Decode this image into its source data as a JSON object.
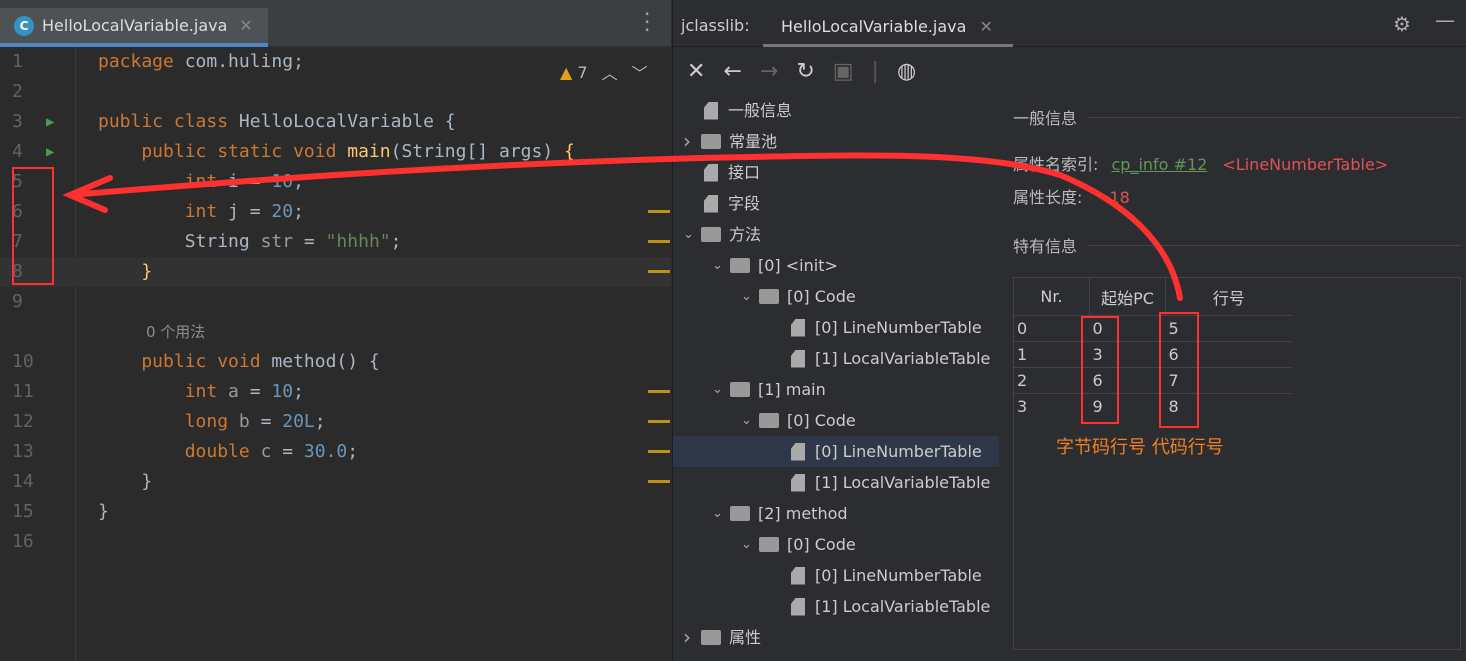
{
  "editor": {
    "tab": {
      "icon": "C",
      "label": "HelloLocalVariable.java",
      "close": "✕"
    },
    "warnings": {
      "count": "7"
    },
    "lines": [
      {
        "n": "1",
        "parts": [
          [
            "kw",
            "package "
          ],
          [
            "id",
            "com.huling;"
          ]
        ]
      },
      {
        "n": "2",
        "parts": []
      },
      {
        "n": "3",
        "run": true,
        "parts": [
          [
            "kw",
            "public class "
          ],
          [
            "id",
            "HelloLocalVariable {"
          ]
        ]
      },
      {
        "n": "4",
        "run": true,
        "parts": [
          [
            "kw",
            "    public static void "
          ],
          [
            "fn",
            "main"
          ],
          [
            "id",
            "(String[] args) "
          ],
          [
            "fn",
            "{"
          ]
        ]
      },
      {
        "n": "5",
        "parts": [
          [
            "kw",
            "        int "
          ],
          [
            "id",
            "i = "
          ],
          [
            "num",
            "10"
          ],
          [
            "id",
            ";"
          ]
        ]
      },
      {
        "n": "6",
        "parts": [
          [
            "kw",
            "        int "
          ],
          [
            "id",
            "j = "
          ],
          [
            "num",
            "20"
          ],
          [
            "id",
            ";"
          ]
        ]
      },
      {
        "n": "7",
        "parts": [
          [
            "id",
            "        String "
          ],
          [
            "var",
            "str"
          ],
          [
            "id",
            " = "
          ],
          [
            "str",
            "\"hhhh\""
          ],
          [
            "id",
            ";"
          ]
        ]
      },
      {
        "n": "8",
        "cur": true,
        "parts": [
          [
            "fn",
            "    }"
          ]
        ]
      },
      {
        "n": "9",
        "parts": []
      },
      {
        "n": "",
        "hint": "0 个用法",
        "parts": []
      },
      {
        "n": "10",
        "parts": [
          [
            "kw",
            "    public void "
          ],
          [
            "id",
            "method() {"
          ]
        ]
      },
      {
        "n": "11",
        "parts": [
          [
            "kw",
            "        int "
          ],
          [
            "var",
            "a"
          ],
          [
            "id",
            " = "
          ],
          [
            "num",
            "10"
          ],
          [
            "id",
            ";"
          ]
        ]
      },
      {
        "n": "12",
        "parts": [
          [
            "kw",
            "        long "
          ],
          [
            "var",
            "b"
          ],
          [
            "id",
            " = "
          ],
          [
            "num",
            "20L"
          ],
          [
            "id",
            ";"
          ]
        ]
      },
      {
        "n": "13",
        "parts": [
          [
            "kw",
            "        double "
          ],
          [
            "var",
            "c"
          ],
          [
            "id",
            " = "
          ],
          [
            "num",
            "30.0"
          ],
          [
            "id",
            ";"
          ]
        ]
      },
      {
        "n": "14",
        "parts": [
          [
            "id",
            "    }"
          ]
        ]
      },
      {
        "n": "15",
        "parts": [
          [
            "id",
            "}"
          ]
        ]
      },
      {
        "n": "16",
        "parts": []
      }
    ]
  },
  "jclasslib": {
    "title": "jclasslib:",
    "tab": "HelloLocalVariable.java",
    "tab_close": "✕",
    "toolbar": [
      "close-icon",
      "back-icon",
      "forward-icon",
      "refresh-icon",
      "save-icon",
      "web-icon"
    ],
    "tree": [
      {
        "d": 0,
        "t": "file",
        "label": "一般信息"
      },
      {
        "d": 0,
        "t": "folder",
        "ch": ">",
        "label": "常量池"
      },
      {
        "d": 0,
        "t": "file",
        "label": "接口"
      },
      {
        "d": 0,
        "t": "file",
        "label": "字段"
      },
      {
        "d": 0,
        "t": "folder",
        "ch": "v",
        "label": "方法"
      },
      {
        "d": 1,
        "t": "folder",
        "ch": "v",
        "label": "[0] <init>"
      },
      {
        "d": 2,
        "t": "folder",
        "ch": "v",
        "label": "[0] Code"
      },
      {
        "d": 3,
        "t": "file",
        "label": "[0] LineNumberTable"
      },
      {
        "d": 3,
        "t": "file",
        "label": "[1] LocalVariableTable"
      },
      {
        "d": 1,
        "t": "folder",
        "ch": "v",
        "label": "[1] main"
      },
      {
        "d": 2,
        "t": "folder",
        "ch": "v",
        "label": "[0] Code"
      },
      {
        "d": 3,
        "t": "file",
        "label": "[0] LineNumberTable",
        "sel": true
      },
      {
        "d": 3,
        "t": "file",
        "label": "[1] LocalVariableTable"
      },
      {
        "d": 1,
        "t": "folder",
        "ch": "v",
        "label": "[2] method"
      },
      {
        "d": 2,
        "t": "folder",
        "ch": "v",
        "label": "[0] Code"
      },
      {
        "d": 3,
        "t": "file",
        "label": "[0] LineNumberTable"
      },
      {
        "d": 3,
        "t": "file",
        "label": "[1] LocalVariableTable"
      },
      {
        "d": 0,
        "t": "folder",
        "ch": ">",
        "label": "属性"
      }
    ],
    "detail": {
      "general_title": "一般信息",
      "name_index_label": "属性名索引:",
      "name_index_link": "cp_info #12",
      "name_index_value": "<LineNumberTable>",
      "length_label": "属性长度:",
      "length_value": "18",
      "specific_title": "特有信息",
      "columns": [
        "Nr.",
        "起始PC",
        "行号"
      ],
      "rows": [
        [
          "0",
          "0",
          "5"
        ],
        [
          "1",
          "3",
          "6"
        ],
        [
          "2",
          "6",
          "7"
        ],
        [
          "3",
          "9",
          "8"
        ]
      ]
    }
  },
  "annotations": {
    "note": "字节码行号 代码行号",
    "color": "#ff3030"
  }
}
